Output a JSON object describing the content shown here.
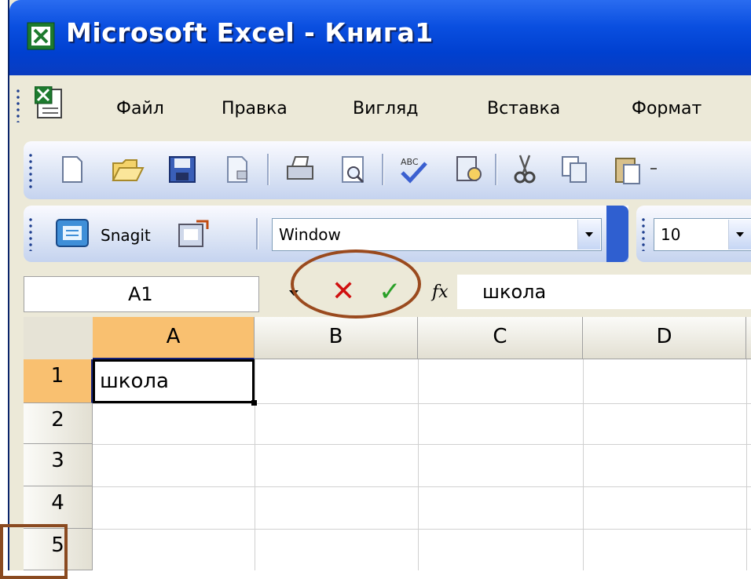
{
  "window": {
    "title": "Microsoft Excel - Книга1"
  },
  "menu": {
    "items": [
      {
        "label": "Файл"
      },
      {
        "label": "Правка"
      },
      {
        "label": "Вигляд"
      },
      {
        "label": "Вставка"
      },
      {
        "label": "Формат"
      }
    ]
  },
  "toolbar": {
    "standard_icons": [
      "new-document-icon",
      "open-folder-icon",
      "save-disk-icon",
      "permission-icon",
      "print-icon",
      "print-preview-icon",
      "spelling-icon",
      "research-icon",
      "cut-icon",
      "copy-icon",
      "paste-icon"
    ],
    "snagit_label": "Snagit",
    "font_name": "Window",
    "font_size": "10"
  },
  "formula_bar": {
    "name_box": "A1",
    "cancel_symbol": "✕",
    "enter_symbol": "✓",
    "fx_label": "fx",
    "content": "школа"
  },
  "sheet": {
    "columns": [
      "A",
      "B",
      "C",
      "D"
    ],
    "rows": [
      "1",
      "2",
      "3",
      "4",
      "5"
    ],
    "active_cell": "A1",
    "cells": {
      "A1": "школа"
    }
  },
  "colors": {
    "titlebar": "#0a4fe0",
    "active_header": "#f9c070",
    "annotation": "#9a4a1e",
    "cancel": "#d01010",
    "enter": "#2aa028"
  }
}
